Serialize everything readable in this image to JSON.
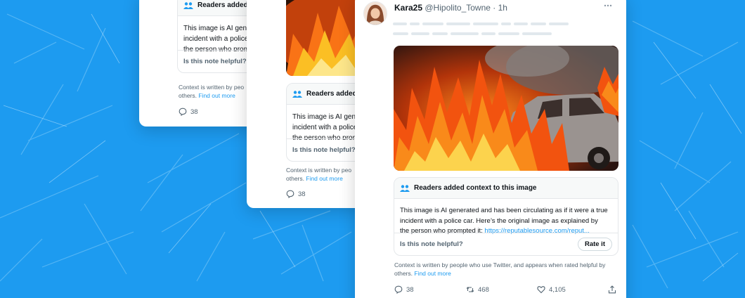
{
  "tweet": {
    "display_name": "Kara25",
    "handle": "@Hipolito_Towne",
    "separator": "·",
    "time": "1h"
  },
  "note": {
    "header_full": "Readers added context to this image",
    "header_truncated": "Readers added co",
    "body_full": "This image is AI generated and has been circulating as if it were a true\nincident with a police car. Here’s the original image as explained by\nthe person who prompted it: ",
    "link_text": "https://reputablesource.com/reput...",
    "body_truncated": "This image is AI gene\nincident with a police\nthe person who prom",
    "helpful_prompt": "Is this note helpful?",
    "rate_label": "Rate it"
  },
  "context_note": {
    "full": "Context is written by people who use Twitter, and appears when rated helpful by\nothers. ",
    "truncated": "Context is written by peo\nothers. ",
    "link": "Find out more"
  },
  "metrics": {
    "replies": "38",
    "retweets": "468",
    "likes": "4,105"
  },
  "icons": [
    "people-icon",
    "reply-icon",
    "retweet-icon",
    "like-icon",
    "share-icon",
    "more-icon"
  ],
  "colors": {
    "background": "#1d9bf0",
    "link": "#1d9bf0",
    "text": "#0f1419",
    "muted": "#536471"
  }
}
